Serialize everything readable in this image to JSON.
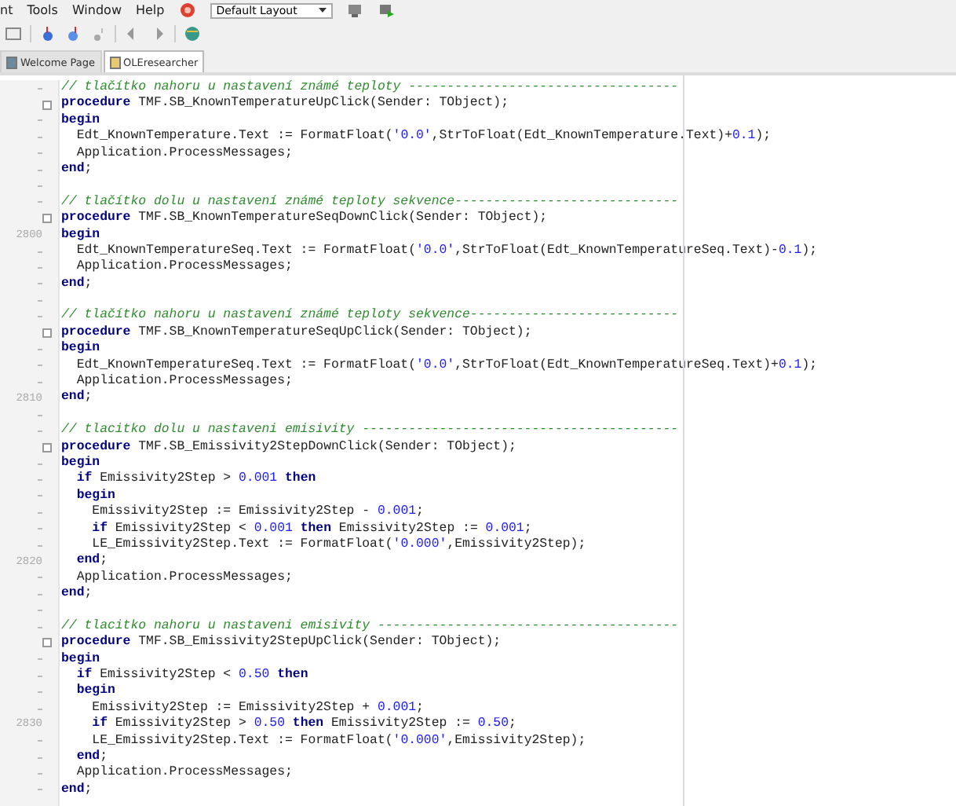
{
  "menu": [
    "nt",
    "Tools",
    "Window",
    "Help"
  ],
  "layout_select": {
    "value": "Default Layout"
  },
  "tabs": [
    {
      "label": "Welcome Page",
      "selected": false
    },
    {
      "label": "OLEresearcher",
      "selected": true
    }
  ],
  "editor": {
    "lines": [
      {
        "kind": "code",
        "tokens": [
          {
            "kind": "comment",
            "text": "// tlačítko nahoru u nastavení známé teploty -----------------------------------"
          }
        ]
      },
      {
        "kind": "code",
        "fold": true,
        "tokens": [
          {
            "kind": "keyword",
            "text": "procedure"
          },
          {
            "kind": "plain",
            "text": " TMF.SB_KnownTemperatureUpClick(Sender: TObject);"
          }
        ]
      },
      {
        "kind": "code",
        "tokens": [
          {
            "kind": "keyword",
            "text": "begin"
          }
        ]
      },
      {
        "kind": "code",
        "tokens": [
          {
            "kind": "plain",
            "text": "  Edt_KnownTemperature.Text := FormatFloat("
          },
          {
            "kind": "string",
            "text": "'0.0'"
          },
          {
            "kind": "plain",
            "text": ",StrToFloat(Edt_KnownTemperature.Text)+"
          },
          {
            "kind": "number",
            "text": "0.1"
          },
          {
            "kind": "plain",
            "text": ");"
          }
        ]
      },
      {
        "kind": "code",
        "tokens": [
          {
            "kind": "plain",
            "text": "  Application.ProcessMessages;"
          }
        ]
      },
      {
        "kind": "code",
        "tokens": [
          {
            "kind": "keyword",
            "text": "end"
          },
          {
            "kind": "plain",
            "text": ";"
          }
        ]
      },
      {
        "kind": "blank"
      },
      {
        "kind": "code",
        "tokens": [
          {
            "kind": "comment",
            "text": "// tlačítko dolu u nastavení známé teploty sekvence-----------------------------"
          }
        ]
      },
      {
        "kind": "code",
        "fold": true,
        "tokens": [
          {
            "kind": "keyword",
            "text": "procedure"
          },
          {
            "kind": "plain",
            "text": " TMF.SB_KnownTemperatureSeqDownClick(Sender: TObject);"
          }
        ]
      },
      {
        "kind": "code",
        "number": "2800",
        "tokens": [
          {
            "kind": "keyword",
            "text": "begin"
          }
        ]
      },
      {
        "kind": "code",
        "tokens": [
          {
            "kind": "plain",
            "text": "  Edt_KnownTemperatureSeq.Text := FormatFloat("
          },
          {
            "kind": "string",
            "text": "'0.0'"
          },
          {
            "kind": "plain",
            "text": ",StrToFloat(Edt_KnownTemperatureSeq.Text)-"
          },
          {
            "kind": "number",
            "text": "0.1"
          },
          {
            "kind": "plain",
            "text": ");"
          }
        ]
      },
      {
        "kind": "code",
        "tokens": [
          {
            "kind": "plain",
            "text": "  Application.ProcessMessages;"
          }
        ]
      },
      {
        "kind": "code",
        "tokens": [
          {
            "kind": "keyword",
            "text": "end"
          },
          {
            "kind": "plain",
            "text": ";"
          }
        ]
      },
      {
        "kind": "blank"
      },
      {
        "kind": "code",
        "tokens": [
          {
            "kind": "comment",
            "text": "// tlačítko nahoru u nastavení známé teploty sekvence---------------------------"
          }
        ]
      },
      {
        "kind": "code",
        "fold": true,
        "tokens": [
          {
            "kind": "keyword",
            "text": "procedure"
          },
          {
            "kind": "plain",
            "text": " TMF.SB_KnownTemperatureSeqUpClick(Sender: TObject);"
          }
        ]
      },
      {
        "kind": "code",
        "tokens": [
          {
            "kind": "keyword",
            "text": "begin"
          }
        ]
      },
      {
        "kind": "code",
        "tokens": [
          {
            "kind": "plain",
            "text": "  Edt_KnownTemperatureSeq.Text := FormatFloat("
          },
          {
            "kind": "string",
            "text": "'0.0'"
          },
          {
            "kind": "plain",
            "text": ",StrToFloat(Edt_KnownTemperatureSeq.Text)+"
          },
          {
            "kind": "number",
            "text": "0.1"
          },
          {
            "kind": "plain",
            "text": ");"
          }
        ]
      },
      {
        "kind": "code",
        "tokens": [
          {
            "kind": "plain",
            "text": "  Application.ProcessMessages;"
          }
        ]
      },
      {
        "kind": "code",
        "number": "2810",
        "tokens": [
          {
            "kind": "keyword",
            "text": "end"
          },
          {
            "kind": "plain",
            "text": ";"
          }
        ]
      },
      {
        "kind": "blank"
      },
      {
        "kind": "code",
        "tokens": [
          {
            "kind": "comment",
            "text": "// tlacitko dolu u nastaveni emisivity -----------------------------------------"
          }
        ]
      },
      {
        "kind": "code",
        "fold": true,
        "tokens": [
          {
            "kind": "keyword",
            "text": "procedure"
          },
          {
            "kind": "plain",
            "text": " TMF.SB_Emissivity2StepDownClick(Sender: TObject);"
          }
        ]
      },
      {
        "kind": "code",
        "tokens": [
          {
            "kind": "keyword",
            "text": "begin"
          }
        ]
      },
      {
        "kind": "code",
        "tokens": [
          {
            "kind": "keyword",
            "text": "  if"
          },
          {
            "kind": "plain",
            "text": " Emissivity2Step > "
          },
          {
            "kind": "number",
            "text": "0.001"
          },
          {
            "kind": "keyword",
            "text": " then"
          }
        ]
      },
      {
        "kind": "code",
        "tokens": [
          {
            "kind": "keyword",
            "text": "  begin"
          }
        ]
      },
      {
        "kind": "code",
        "tokens": [
          {
            "kind": "plain",
            "text": "    Emissivity2Step := Emissivity2Step - "
          },
          {
            "kind": "number",
            "text": "0.001"
          },
          {
            "kind": "plain",
            "text": ";"
          }
        ]
      },
      {
        "kind": "code",
        "tokens": [
          {
            "kind": "keyword",
            "text": "    if"
          },
          {
            "kind": "plain",
            "text": " Emissivity2Step < "
          },
          {
            "kind": "number",
            "text": "0.001"
          },
          {
            "kind": "keyword",
            "text": " then"
          },
          {
            "kind": "plain",
            "text": " Emissivity2Step := "
          },
          {
            "kind": "number",
            "text": "0.001"
          },
          {
            "kind": "plain",
            "text": ";"
          }
        ]
      },
      {
        "kind": "code",
        "tokens": [
          {
            "kind": "plain",
            "text": "    LE_Emissivity2Step.Text := FormatFloat("
          },
          {
            "kind": "string",
            "text": "'0.000'"
          },
          {
            "kind": "plain",
            "text": ",Emissivity2Step);"
          }
        ]
      },
      {
        "kind": "code",
        "number": "2820",
        "tokens": [
          {
            "kind": "keyword",
            "text": "  end"
          },
          {
            "kind": "plain",
            "text": ";"
          }
        ]
      },
      {
        "kind": "code",
        "tokens": [
          {
            "kind": "plain",
            "text": "  Application.ProcessMessages;"
          }
        ]
      },
      {
        "kind": "code",
        "tokens": [
          {
            "kind": "keyword",
            "text": "end"
          },
          {
            "kind": "plain",
            "text": ";"
          }
        ]
      },
      {
        "kind": "blank"
      },
      {
        "kind": "code",
        "tokens": [
          {
            "kind": "comment",
            "text": "// tlacitko nahoru u nastaveni emisivity ---------------------------------------"
          }
        ]
      },
      {
        "kind": "code",
        "fold": true,
        "tokens": [
          {
            "kind": "keyword",
            "text": "procedure"
          },
          {
            "kind": "plain",
            "text": " TMF.SB_Emissivity2StepUpClick(Sender: TObject);"
          }
        ]
      },
      {
        "kind": "code",
        "tokens": [
          {
            "kind": "keyword",
            "text": "begin"
          }
        ]
      },
      {
        "kind": "code",
        "tokens": [
          {
            "kind": "keyword",
            "text": "  if"
          },
          {
            "kind": "plain",
            "text": " Emissivity2Step < "
          },
          {
            "kind": "number",
            "text": "0.50"
          },
          {
            "kind": "keyword",
            "text": " then"
          }
        ]
      },
      {
        "kind": "code",
        "tokens": [
          {
            "kind": "keyword",
            "text": "  begin"
          }
        ]
      },
      {
        "kind": "code",
        "tokens": [
          {
            "kind": "plain",
            "text": "    Emissivity2Step := Emissivity2Step + "
          },
          {
            "kind": "number",
            "text": "0.001"
          },
          {
            "kind": "plain",
            "text": ";"
          }
        ]
      },
      {
        "kind": "code",
        "number": "2830",
        "tokens": [
          {
            "kind": "keyword",
            "text": "    if"
          },
          {
            "kind": "plain",
            "text": " Emissivity2Step > "
          },
          {
            "kind": "number",
            "text": "0.50"
          },
          {
            "kind": "keyword",
            "text": " then"
          },
          {
            "kind": "plain",
            "text": " Emissivity2Step := "
          },
          {
            "kind": "number",
            "text": "0.50"
          },
          {
            "kind": "plain",
            "text": ";"
          }
        ]
      },
      {
        "kind": "code",
        "tokens": [
          {
            "kind": "plain",
            "text": "    LE_Emissivity2Step.Text := FormatFloat("
          },
          {
            "kind": "string",
            "text": "'0.000'"
          },
          {
            "kind": "plain",
            "text": ",Emissivity2Step);"
          }
        ]
      },
      {
        "kind": "code",
        "tokens": [
          {
            "kind": "keyword",
            "text": "  end"
          },
          {
            "kind": "plain",
            "text": ";"
          }
        ]
      },
      {
        "kind": "code",
        "tokens": [
          {
            "kind": "plain",
            "text": "  Application.ProcessMessages;"
          }
        ]
      },
      {
        "kind": "code",
        "tokens": [
          {
            "kind": "keyword",
            "text": "end"
          },
          {
            "kind": "plain",
            "text": ";"
          }
        ]
      }
    ]
  }
}
